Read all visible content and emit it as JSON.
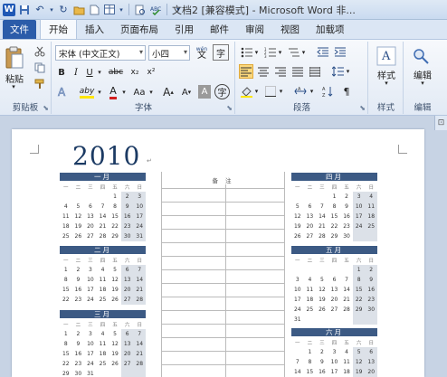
{
  "titlebar": {
    "title": "文档2 [兼容模式] - Microsoft Word 非...",
    "quick_access": [
      "word-logo-icon",
      "save-icon",
      "undo-icon",
      "redo-icon",
      "open-icon",
      "new-icon",
      "table-icon",
      "print-preview-icon",
      "spelling-icon",
      "dropdown-icon"
    ]
  },
  "tabs": [
    "文件",
    "开始",
    "插入",
    "页面布局",
    "引用",
    "邮件",
    "审阅",
    "视图",
    "加载项"
  ],
  "active_tab": "开始",
  "ribbon": {
    "clipboard": {
      "label": "剪贴板",
      "paste_label": "粘贴"
    },
    "font": {
      "label": "字体",
      "font_name": "宋体 (中文正文)",
      "font_size": "小四",
      "wen_label": "wén",
      "bold": "B",
      "italic": "I",
      "underline": "U",
      "strike": "abc",
      "subscript": "x₂",
      "superscript": "x²",
      "clear": "A",
      "highlight": "aby",
      "font_color": "A",
      "case": "Aa",
      "grow": "A",
      "shrink": "A",
      "char_border": "A"
    },
    "paragraph": {
      "label": "段落"
    },
    "styles": {
      "label": "样式",
      "button": "样式"
    },
    "editing": {
      "label": "编辑",
      "button": "编辑"
    }
  },
  "document": {
    "year": "2010",
    "notes_header": "备 注",
    "weekday_header": [
      "一",
      "二",
      "三",
      "四",
      "五",
      "六",
      "日"
    ],
    "months": [
      {
        "name": "一月",
        "rows": [
          [
            "",
            "",
            "",
            "",
            "1",
            "2",
            "3"
          ],
          [
            "4",
            "5",
            "6",
            "7",
            "8",
            "9",
            "10"
          ],
          [
            "11",
            "12",
            "13",
            "14",
            "15",
            "16",
            "17"
          ],
          [
            "18",
            "19",
            "20",
            "21",
            "22",
            "23",
            "24"
          ],
          [
            "25",
            "26",
            "27",
            "28",
            "29",
            "30",
            "31"
          ]
        ]
      },
      {
        "name": "二月",
        "rows": [
          [
            "1",
            "2",
            "3",
            "4",
            "5",
            "6",
            "7"
          ],
          [
            "8",
            "9",
            "10",
            "11",
            "12",
            "13",
            "14"
          ],
          [
            "15",
            "16",
            "17",
            "18",
            "19",
            "20",
            "21"
          ],
          [
            "22",
            "23",
            "24",
            "25",
            "26",
            "27",
            "28"
          ]
        ]
      },
      {
        "name": "三月",
        "rows": [
          [
            "1",
            "2",
            "3",
            "4",
            "5",
            "6",
            "7"
          ],
          [
            "8",
            "9",
            "10",
            "11",
            "12",
            "13",
            "14"
          ],
          [
            "15",
            "16",
            "17",
            "18",
            "19",
            "20",
            "21"
          ],
          [
            "22",
            "23",
            "24",
            "25",
            "26",
            "27",
            "28"
          ],
          [
            "29",
            "30",
            "31",
            "",
            "",
            "",
            ""
          ]
        ]
      },
      {
        "name": "四月",
        "rows": [
          [
            "",
            "",
            "",
            "1",
            "2",
            "3",
            "4"
          ],
          [
            "5",
            "6",
            "7",
            "8",
            "9",
            "10",
            "11"
          ],
          [
            "12",
            "13",
            "14",
            "15",
            "16",
            "17",
            "18"
          ],
          [
            "19",
            "20",
            "21",
            "22",
            "23",
            "24",
            "25"
          ],
          [
            "26",
            "27",
            "28",
            "29",
            "30",
            "",
            ""
          ]
        ]
      },
      {
        "name": "五月",
        "rows": [
          [
            "",
            "",
            "",
            "",
            "",
            "1",
            "2"
          ],
          [
            "3",
            "4",
            "5",
            "6",
            "7",
            "8",
            "9"
          ],
          [
            "10",
            "11",
            "12",
            "13",
            "14",
            "15",
            "16"
          ],
          [
            "17",
            "18",
            "19",
            "20",
            "21",
            "22",
            "23"
          ],
          [
            "24",
            "25",
            "26",
            "27",
            "28",
            "29",
            "30"
          ],
          [
            "31",
            "",
            "",
            "",
            "",
            "",
            ""
          ]
        ]
      },
      {
        "name": "六月",
        "rows": [
          [
            "",
            "1",
            "2",
            "3",
            "4",
            "5",
            "6"
          ],
          [
            "7",
            "8",
            "9",
            "10",
            "11",
            "12",
            "13"
          ],
          [
            "14",
            "15",
            "16",
            "17",
            "18",
            "19",
            "20"
          ]
        ]
      }
    ]
  }
}
